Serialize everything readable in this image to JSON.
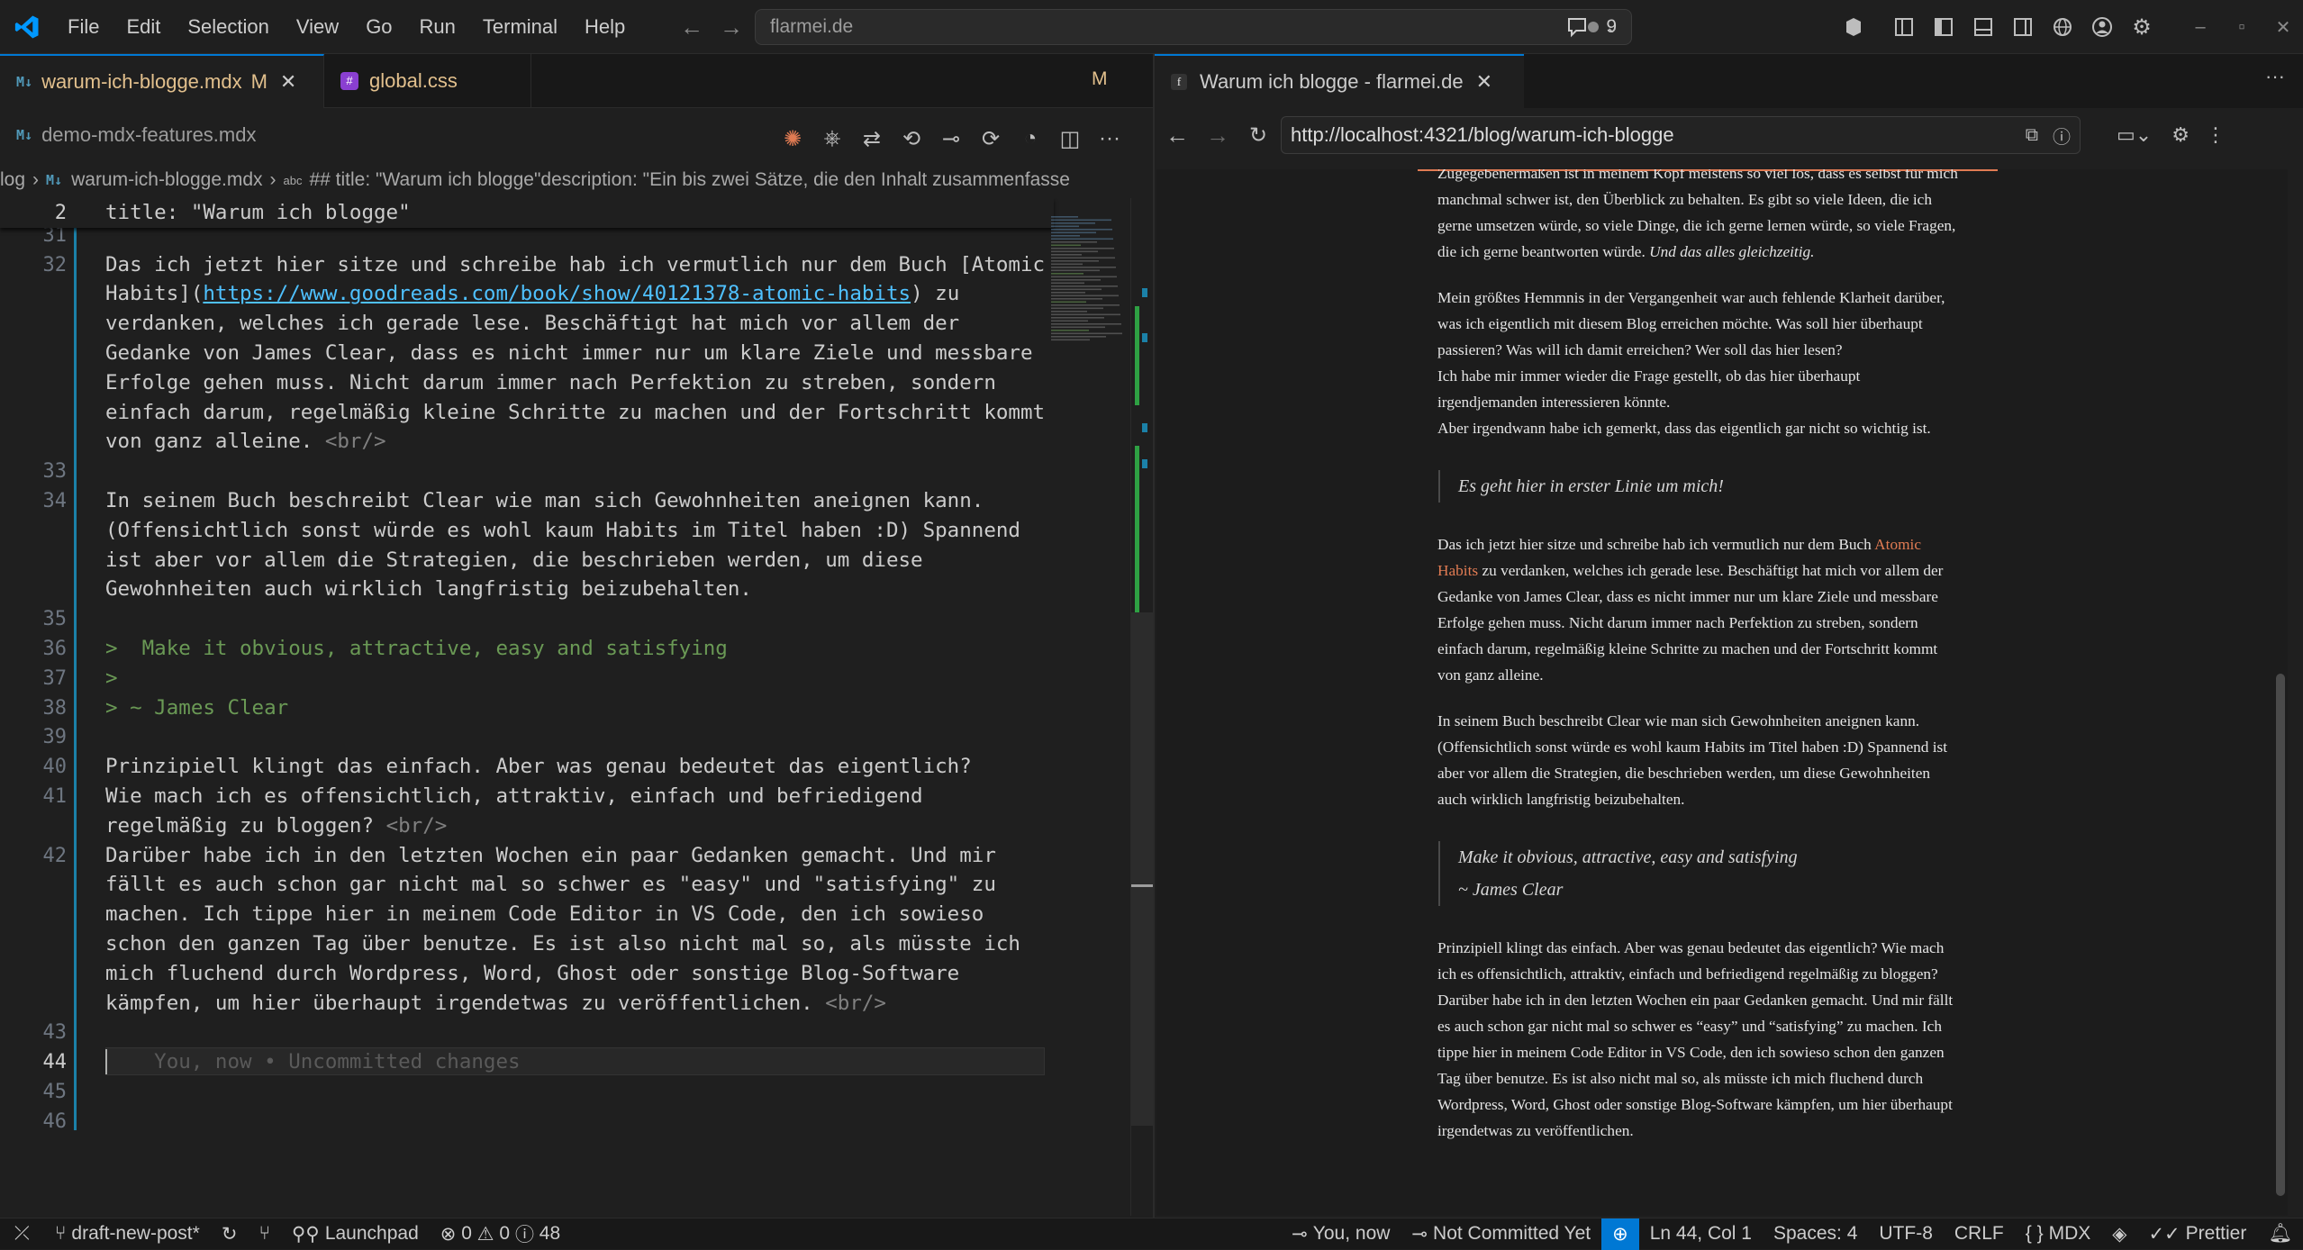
{
  "menu": [
    "File",
    "Edit",
    "Selection",
    "View",
    "Go",
    "Run",
    "Terminal",
    "Help"
  ],
  "command_center": {
    "text": "flarmei.de",
    "problems_count": "9"
  },
  "editor_tabs": [
    {
      "label": "warum-ich-blogge.mdx",
      "badge": "M",
      "icon": "mdx-icon"
    },
    {
      "label": "global.css",
      "icon": "css-icon"
    }
  ],
  "tabs_badge": "M",
  "second_tab": {
    "label": "demo-mdx-features.mdx",
    "icon": "mdx-icon"
  },
  "breadcrumb": {
    "folder": "log",
    "file": "warum-ich-blogge.mdx",
    "symbol": "## title: \"Warum ich blogge\"description: \"Ein bis zwei Sätze, die den Inhalt zusammenfasse"
  },
  "sticky": {
    "num": "2",
    "text": "title: \"Warum ich blogge\""
  },
  "code_lines": [
    {
      "num": "30",
      "segs": [
        {
          "t": "> Es geht hier in erster Linie um mich!",
          "c": "#6a9955"
        }
      ],
      "partial": true
    },
    {
      "num": "31",
      "segs": [
        {
          "t": "",
          "c": "#ccc"
        }
      ]
    },
    {
      "num": "32",
      "segs": [
        {
          "t": "Das ich jetzt hier sitze und schreibe hab ich vermutlich nur dem Buch [Atomic",
          "c": "#ccc"
        }
      ]
    },
    {
      "num": "",
      "segs": [
        {
          "t": "Habits]",
          "c": "#ccc"
        },
        {
          "t": "(",
          "c": "#ccc"
        },
        {
          "t": "https://www.goodreads.com/book/show/40121378-atomic-habits",
          "c": "#4fc1ff",
          "u": true
        },
        {
          "t": ") zu",
          "c": "#ccc"
        }
      ]
    },
    {
      "num": "",
      "segs": [
        {
          "t": "verdanken, welches ich gerade lese. Beschäftigt hat mich vor allem der",
          "c": "#ccc"
        }
      ]
    },
    {
      "num": "",
      "segs": [
        {
          "t": "Gedanke von James Clear, dass es nicht immer nur um klare Ziele und messbare",
          "c": "#ccc"
        }
      ]
    },
    {
      "num": "",
      "segs": [
        {
          "t": "Erfolge gehen muss. Nicht darum immer nach Perfektion zu streben, sondern",
          "c": "#ccc"
        }
      ]
    },
    {
      "num": "",
      "segs": [
        {
          "t": "einfach darum, regelmäßig kleine Schritte zu machen und der Fortschritt kommt",
          "c": "#ccc"
        }
      ]
    },
    {
      "num": "",
      "segs": [
        {
          "t": "von ganz alleine. ",
          "c": "#ccc"
        },
        {
          "t": "<br/>",
          "c": "#808080"
        }
      ]
    },
    {
      "num": "33",
      "segs": [
        {
          "t": "",
          "c": "#ccc"
        }
      ]
    },
    {
      "num": "34",
      "segs": [
        {
          "t": "In seinem Buch beschreibt Clear wie man sich Gewohnheiten aneignen kann.",
          "c": "#ccc"
        }
      ]
    },
    {
      "num": "",
      "segs": [
        {
          "t": "(Offensichtlich sonst würde es wohl kaum Habits im Titel haben :D) Spannend",
          "c": "#ccc"
        }
      ]
    },
    {
      "num": "",
      "segs": [
        {
          "t": "ist aber vor allem die Strategien, die beschrieben werden, um diese",
          "c": "#ccc"
        }
      ]
    },
    {
      "num": "",
      "segs": [
        {
          "t": "Gewohnheiten auch wirklich langfristig beizubehalten.",
          "c": "#ccc"
        }
      ]
    },
    {
      "num": "35",
      "segs": [
        {
          "t": "",
          "c": "#ccc"
        }
      ]
    },
    {
      "num": "36",
      "segs": [
        {
          "t": ">  Make it obvious, attractive, easy and satisfying",
          "c": "#6a9955"
        }
      ]
    },
    {
      "num": "37",
      "segs": [
        {
          "t": ">",
          "c": "#6a9955"
        }
      ]
    },
    {
      "num": "38",
      "segs": [
        {
          "t": "> ~ James Clear",
          "c": "#6a9955"
        }
      ]
    },
    {
      "num": "39",
      "segs": [
        {
          "t": "",
          "c": "#ccc"
        }
      ]
    },
    {
      "num": "40",
      "segs": [
        {
          "t": "Prinzipiell klingt das einfach. Aber was genau bedeutet das eigentlich?",
          "c": "#ccc"
        }
      ]
    },
    {
      "num": "41",
      "segs": [
        {
          "t": "Wie mach ich es offensichtlich, attraktiv, einfach und befriedigend",
          "c": "#ccc"
        }
      ]
    },
    {
      "num": "",
      "segs": [
        {
          "t": "regelmäßig zu bloggen? ",
          "c": "#ccc"
        },
        {
          "t": "<br/>",
          "c": "#808080"
        }
      ]
    },
    {
      "num": "42",
      "segs": [
        {
          "t": "Darüber habe ich in den letzten Wochen ein paar Gedanken gemacht. Und mir",
          "c": "#ccc"
        }
      ]
    },
    {
      "num": "",
      "segs": [
        {
          "t": "fällt es auch schon gar nicht mal so schwer es \"easy\" und \"satisfying\" zu",
          "c": "#ccc"
        }
      ]
    },
    {
      "num": "",
      "segs": [
        {
          "t": "machen. Ich tippe hier in meinem Code Editor in VS Code, den ich sowieso",
          "c": "#ccc"
        }
      ]
    },
    {
      "num": "",
      "segs": [
        {
          "t": "schon den ganzen Tag über benutze. Es ist also nicht mal so, als müsste ich",
          "c": "#ccc"
        }
      ]
    },
    {
      "num": "",
      "segs": [
        {
          "t": "mich fluchend durch Wordpress, Word, Ghost oder sonstige Blog-Software",
          "c": "#ccc"
        }
      ]
    },
    {
      "num": "",
      "segs": [
        {
          "t": "kämpfen, um hier überhaupt irgendetwas zu veröffentlichen. ",
          "c": "#ccc"
        },
        {
          "t": "<br/>",
          "c": "#808080"
        }
      ]
    },
    {
      "num": "43",
      "segs": [
        {
          "t": "",
          "c": "#ccc"
        }
      ]
    },
    {
      "num": "44",
      "segs": [
        {
          "t": "    You, now • Uncommitted changes",
          "c": "#5a5a5a"
        }
      ],
      "current": true
    },
    {
      "num": "45",
      "segs": [
        {
          "t": "",
          "c": "#ccc"
        }
      ]
    },
    {
      "num": "46",
      "segs": [
        {
          "t": "",
          "c": "#ccc"
        }
      ]
    }
  ],
  "preview_tab": {
    "label": "Warum ich blogge - flarmei.de",
    "favicon": "f"
  },
  "url": "http://localhost:4321/blog/warum-ich-blogge",
  "preview_blocks": [
    {
      "type": "p",
      "lines": [
        "Zugegebenermaßen ist in meinem Kopf meistens so viel los, dass es selbst für mich",
        "manchmal schwer ist, den Überblick zu behalten. Es gibt so viele Ideen, die ich",
        "gerne umsetzen würde, so viele Dinge, die ich gerne lernen würde, so viele Fragen,"
      ],
      "last": "die ich gerne beantworten würde. ",
      "em": "Und das alles gleichzeitig."
    },
    {
      "type": "p",
      "lines": [
        "Mein größtes Hemmnis in der Vergangenheit war auch fehlende Klarheit darüber,",
        "was ich eigentlich mit diesem Blog erreichen möchte. Was soll hier überhaupt",
        "passieren? Was will ich damit erreichen? Wer soll das hier lesen?",
        "Ich habe mir immer wieder die Frage gestellt, ob das hier überhaupt",
        "irgendjemanden interessieren könnte.",
        "Aber irgendwann habe ich gemerkt, dass das eigentlich gar nicht so wichtig ist."
      ]
    },
    {
      "type": "q",
      "lines": [
        "Es geht hier in erster Linie um mich!"
      ]
    },
    {
      "type": "p",
      "lines": [
        "Das ich jetzt hier sitze und schreibe hab ich vermutlich nur dem Buch ",
        "Habits zu verdanken, welches ich gerade lese. Beschäftigt hat mich vor allem der",
        "Gedanke von James Clear, dass es nicht immer nur um klare Ziele und messbare",
        "Erfolge gehen muss. Nicht darum immer nach Perfektion zu streben, sondern",
        "einfach darum, regelmäßig kleine Schritte zu machen und der Fortschritt kommt",
        "von ganz alleine."
      ],
      "link1": "Atomic",
      "link2": "Habits"
    },
    {
      "type": "p",
      "lines": [
        "In seinem Buch beschreibt Clear wie man sich Gewohnheiten aneignen kann.",
        "(Offensichtlich sonst würde es wohl kaum Habits im Titel haben :D) Spannend ist",
        "aber vor allem die Strategien, die beschrieben werden, um diese Gewohnheiten",
        "auch wirklich langfristig beizubehalten."
      ]
    },
    {
      "type": "q",
      "lines": [
        "Make it obvious, attractive, easy and satisfying",
        "~ James Clear"
      ]
    },
    {
      "type": "p",
      "lines": [
        "Prinzipiell klingt das einfach. Aber was genau bedeutet das eigentlich? Wie mach",
        "ich es offensichtlich, attraktiv, einfach und befriedigend regelmäßig zu bloggen?",
        "Darüber habe ich in den letzten Wochen ein paar Gedanken gemacht. Und mir fällt",
        "es auch schon gar nicht mal so schwer es “easy” und “satisfying” zu machen. Ich",
        "tippe hier in meinem Code Editor in VS Code, den ich sowieso schon den ganzen",
        "Tag über benutze. Es ist also nicht mal so, als müsste ich mich fluchend durch",
        "Wordpress, Word, Ghost oder sonstige Blog-Software kämpfen, um hier überhaupt",
        "irgendetwas zu veröffentlichen."
      ]
    }
  ],
  "status": {
    "branch": "draft-new-post*",
    "launchpad": "Launchpad",
    "errors": "0",
    "warnings": "0",
    "infos": "48",
    "blame": "You, now",
    "commit": "Not Committed Yet",
    "cursor": "Ln 44, Col 1",
    "spaces": "Spaces: 4",
    "encoding": "UTF-8",
    "eol": "CRLF",
    "lang": "MDX",
    "prettier": "Prettier"
  },
  "colors": {
    "accent": "#0078d4",
    "link": "#e07b53",
    "added": "#2ea043",
    "statusRemote": "#0078d4"
  }
}
